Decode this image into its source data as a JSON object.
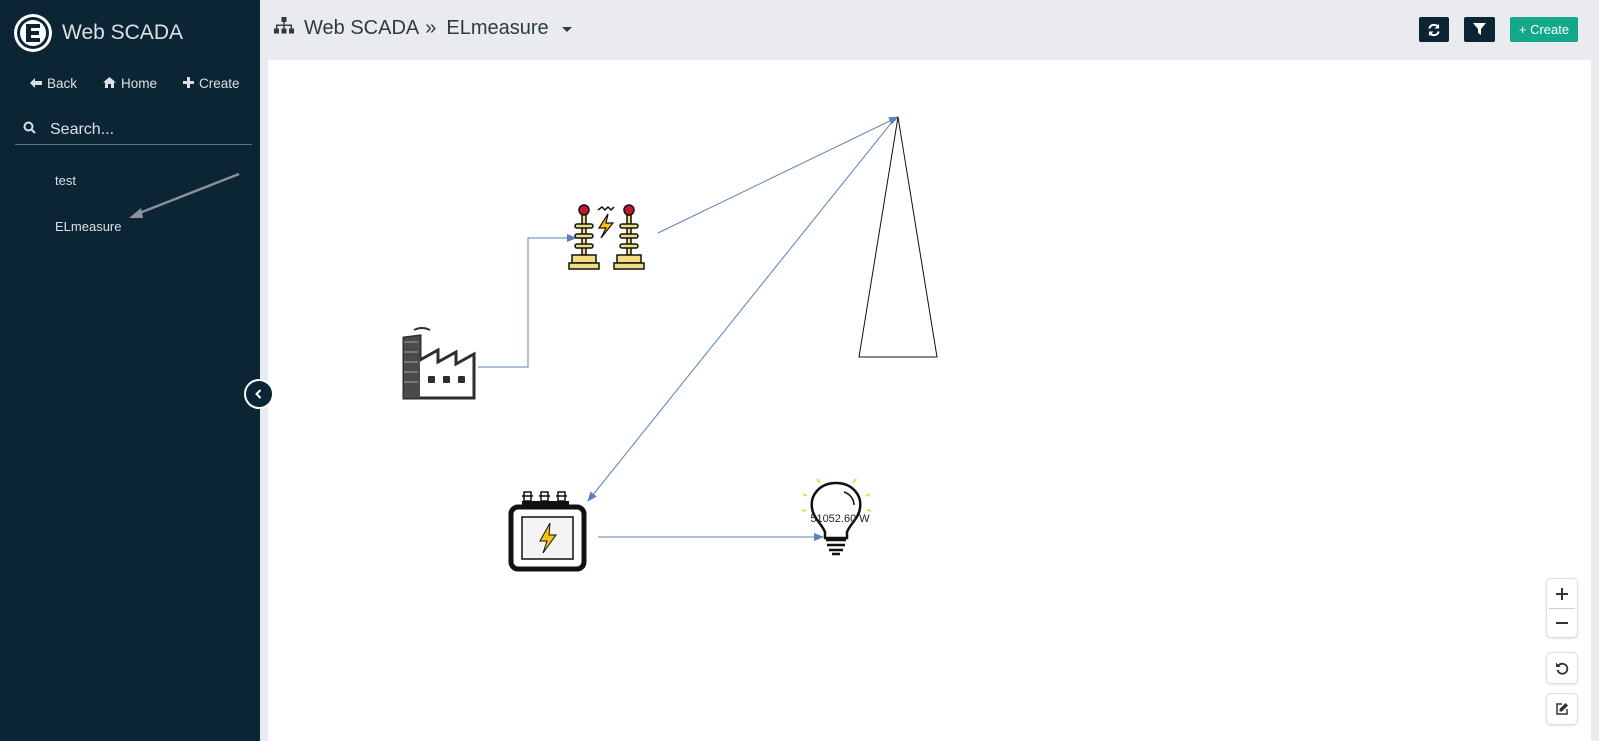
{
  "sidebar": {
    "brand": "Web SCADA",
    "nav": {
      "back": "Back",
      "home": "Home",
      "create": "Create"
    },
    "search": {
      "placeholder": "Search..."
    },
    "items": [
      {
        "label": "test"
      },
      {
        "label": "ELmeasure"
      }
    ]
  },
  "header": {
    "breadcrumb": {
      "root": "Web SCADA",
      "separator": "»",
      "current": "ELmeasure"
    },
    "create_label": "+ Create"
  },
  "diagram": {
    "bulb_reading": "51052.60 W"
  },
  "colors": {
    "sidebar_bg": "#0b2535",
    "accent_green": "#13a889",
    "connector": "#5b7fbf"
  }
}
